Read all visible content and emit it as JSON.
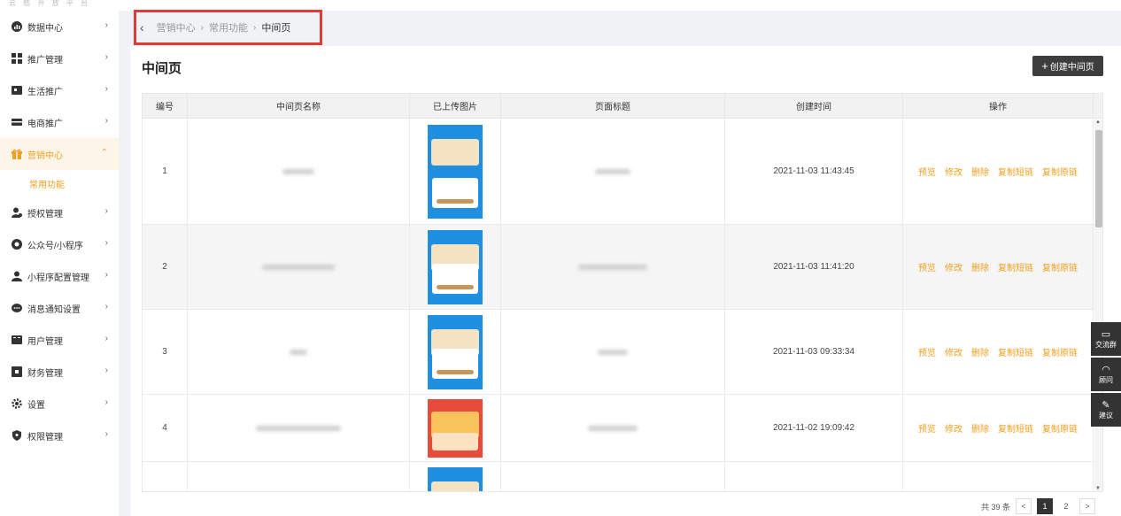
{
  "brand": "云 皓 开 放 平 台",
  "sidebar": {
    "items": [
      {
        "label": "数据中心",
        "icon": "chart-circle-icon",
        "chevron": "›"
      },
      {
        "label": "推广管理",
        "icon": "grid-icon",
        "chevron": "›"
      },
      {
        "label": "生活推广",
        "icon": "screen-icon",
        "chevron": "›"
      },
      {
        "label": "电商推广",
        "icon": "card-icon",
        "chevron": "›"
      },
      {
        "label": "营销中心",
        "icon": "gift-icon",
        "chevron": "⌃"
      },
      {
        "label": "授权管理",
        "icon": "user-key-icon",
        "chevron": "›"
      },
      {
        "label": "公众号/小程序",
        "icon": "mini-program-icon",
        "chevron": "›"
      },
      {
        "label": "小程序配置管理",
        "icon": "person-icon",
        "chevron": "›"
      },
      {
        "label": "消息通知设置",
        "icon": "chat-bubble-icon",
        "chevron": "›"
      },
      {
        "label": "用户管理",
        "icon": "users-card-icon",
        "chevron": "›"
      },
      {
        "label": "财务管理",
        "icon": "finance-icon",
        "chevron": "›"
      },
      {
        "label": "设置",
        "icon": "gear-icon",
        "chevron": "›"
      },
      {
        "label": "权限管理",
        "icon": "shield-icon",
        "chevron": "›"
      }
    ],
    "subitem": "常用功能"
  },
  "breadcrumb": {
    "back": "‹",
    "items": [
      "营销中心",
      "常用功能",
      "中间页"
    ],
    "separator": "›"
  },
  "page": {
    "title": "中间页",
    "create_button_icon": "+",
    "create_button": "创建中间页"
  },
  "table": {
    "headers": [
      "编号",
      "中间页名称",
      "已上传图片",
      "页面标题",
      "创建时间",
      "操作"
    ],
    "rows": [
      {
        "id": "1",
        "created": "2021-11-03 11:43:45",
        "thumb": "blue"
      },
      {
        "id": "2",
        "created": "2021-11-03 11:41:20",
        "thumb": "blue"
      },
      {
        "id": "3",
        "created": "2021-11-03 09:33:34",
        "thumb": "blue"
      },
      {
        "id": "4",
        "created": "2021-11-02 19:09:42",
        "thumb": "red"
      }
    ],
    "actions": [
      "预览",
      "修改",
      "删除",
      "复制短链",
      "复制原链"
    ]
  },
  "pagination": {
    "total": "共 39 条",
    "prev": "<",
    "pages": [
      "1",
      "2"
    ],
    "next": ">"
  },
  "float_tools": [
    {
      "label": "交流群",
      "icon": "chat-group-icon",
      "glyph": "▭"
    },
    {
      "label": "顾问",
      "icon": "headset-icon",
      "glyph": "◠"
    },
    {
      "label": "建议",
      "icon": "edit-note-icon",
      "glyph": "✎"
    }
  ],
  "colors": {
    "accent": "#f0a020",
    "highlight_border": "#e53935",
    "dark_button": "#3d3d3d"
  }
}
